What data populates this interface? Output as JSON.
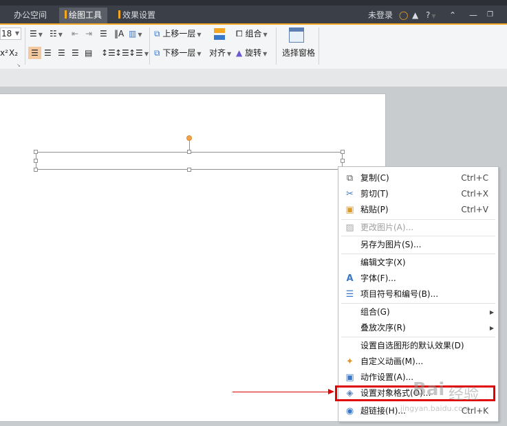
{
  "window": {
    "tabs": [
      "办公空间",
      "绘图工具",
      "效果设置"
    ],
    "active_tab": "绘图工具",
    "login_label": "未登录",
    "help_label": "?"
  },
  "ribbon": {
    "font_size": "18",
    "subscript_label": "X₂",
    "superscript_label": "x²",
    "bring_forward": "上移一层",
    "send_backward": "下移一层",
    "align": "对齐",
    "group": "组合",
    "rotate": "旋转",
    "selection_pane": "选择窗格"
  },
  "context_menu": {
    "items": [
      {
        "label": "复制(C)",
        "shortcut": "Ctrl+C",
        "icon": "copy-icon"
      },
      {
        "label": "剪切(T)",
        "shortcut": "Ctrl+X",
        "icon": "scissors-icon"
      },
      {
        "label": "粘贴(P)",
        "shortcut": "Ctrl+V",
        "icon": "paste-icon"
      },
      {
        "label": "更改图片(A)...",
        "icon": "change-picture-icon",
        "disabled": true
      },
      {
        "label": "另存为图片(S)..."
      },
      {
        "label": "编辑文字(X)"
      },
      {
        "label": "字体(F)...",
        "icon": "font-icon"
      },
      {
        "label": "项目符号和编号(B)...",
        "icon": "bullets-icon"
      },
      {
        "label": "组合(G)",
        "submenu": true
      },
      {
        "label": "叠放次序(R)",
        "submenu": true
      },
      {
        "label": "设置自选图形的默认效果(D)"
      },
      {
        "label": "自定义动画(M)...",
        "icon": "animation-icon"
      },
      {
        "label": "动作设置(A)...",
        "icon": "action-icon"
      },
      {
        "label": "设置对象格式(O)...",
        "icon": "format-object-icon",
        "highlighted": true
      },
      {
        "label": "超链接(H)...",
        "shortcut": "Ctrl+K",
        "icon": "hyperlink-icon"
      }
    ]
  },
  "watermark": {
    "brand": "Bai",
    "brand_cn": "经验",
    "url": "jingyan.baidu.com"
  },
  "colors": {
    "accent": "#f5a623",
    "highlight_red": "#e10000",
    "titlebar": "#3b3f47"
  }
}
